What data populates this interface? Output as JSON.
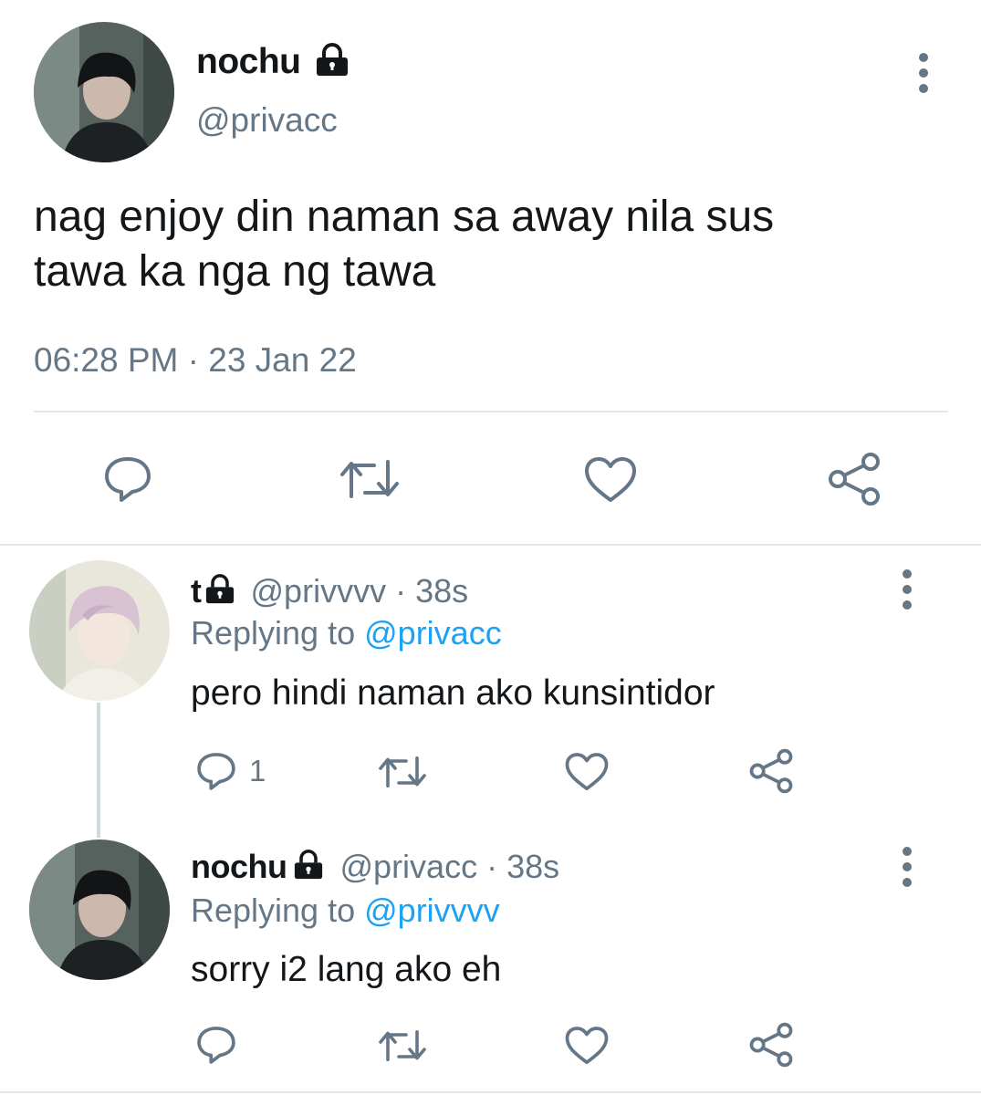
{
  "main_tweet": {
    "name": "nochu",
    "handle": "@privacc",
    "text_line1": "nag enjoy din naman sa away nila sus",
    "text_line2": "tawa ka nga ng tawa",
    "timestamp": "06:28 PM · 23 Jan 22"
  },
  "replies": [
    {
      "name": "t",
      "handle": "@privvvv",
      "time": "· 38s",
      "replying_prefix": "Replying to",
      "replying_handle": "@privacc",
      "text": "pero hindi naman ako kunsintidor",
      "reply_count": "1"
    },
    {
      "name": "nochu",
      "handle": "@privacc",
      "time": "· 38s",
      "replying_prefix": "Replying to",
      "replying_handle": "@privvvv",
      "text": "sorry i2 lang ako eh",
      "reply_count": ""
    }
  ],
  "icons": {
    "reply": "reply-icon",
    "retweet": "retweet-icon",
    "like": "heart-icon",
    "share": "share-icon",
    "menu": "more-vertical-icon",
    "lock": "lock-icon"
  },
  "colors": {
    "text": "#14171a",
    "secondary": "#657786",
    "link": "#1da1f2",
    "divider": "#e1e8ed"
  }
}
